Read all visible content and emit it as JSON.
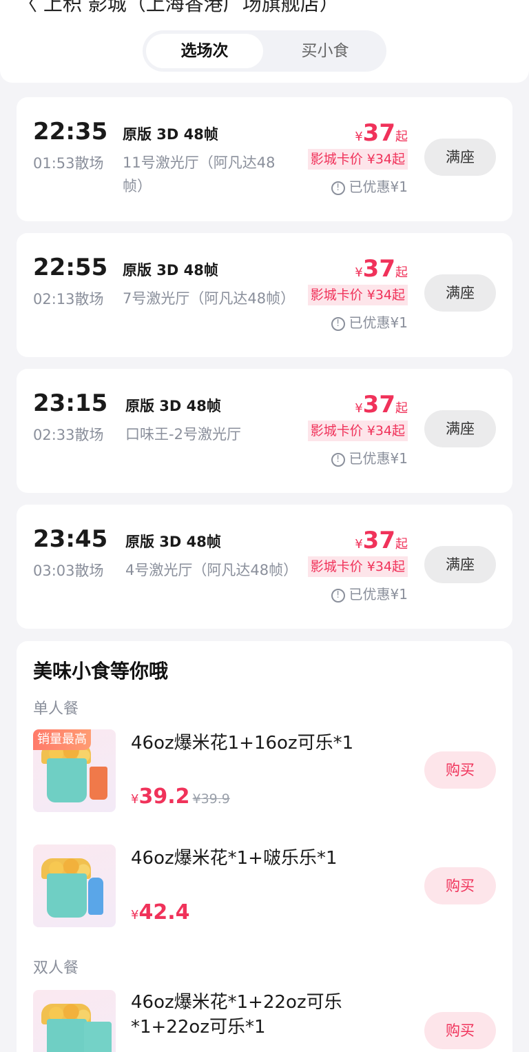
{
  "header": {
    "title_cut": "〈  上积        影城（上海香港广场旗舰店）",
    "tabs": [
      "选场次",
      "买小食"
    ]
  },
  "showtimes": [
    {
      "time": "22:35",
      "end": "01:53散场",
      "format": "原版 3D 48帧",
      "hall": "11号激光厅（阿凡达48帧）",
      "yen": "¥",
      "price": "37",
      "qi": "起",
      "card_price": "影城卡价 ¥34起",
      "discount": "已优惠¥1",
      "status": "满座"
    },
    {
      "time": "22:55",
      "end": "02:13散场",
      "format": "原版 3D 48帧",
      "hall": "7号激光厅（阿凡达48帧）",
      "yen": "¥",
      "price": "37",
      "qi": "起",
      "card_price": "影城卡价 ¥34起",
      "discount": "已优惠¥1",
      "status": "满座"
    },
    {
      "time": "23:15",
      "end": "02:33散场",
      "format": "原版 3D 48帧",
      "hall": "口味王-2号激光厅",
      "yen": "¥",
      "price": "37",
      "qi": "起",
      "card_price": "影城卡价 ¥34起",
      "discount": "已优惠¥1",
      "status": "满座"
    },
    {
      "time": "23:45",
      "end": "03:03散场",
      "format": "原版 3D 48帧",
      "hall": "4号激光厅（阿凡达48帧）",
      "yen": "¥",
      "price": "37",
      "qi": "起",
      "card_price": "影城卡价 ¥34起",
      "discount": "已优惠¥1",
      "status": "满座"
    }
  ],
  "snacks": {
    "title": "美味小食等你哦",
    "single_label": "单人餐",
    "double_label": "双人餐",
    "items": [
      {
        "badge": "销量最高",
        "name": "46oz爆米花1+16oz可乐*1",
        "yen": "¥",
        "price": "39.2",
        "original": "¥39.9",
        "buy": "购买"
      },
      {
        "name": "46oz爆米花*1+啵乐乐*1",
        "yen": "¥",
        "price": "42.4",
        "buy": "购买"
      },
      {
        "name": "46oz爆米花*1+22oz可乐*1+22oz可乐*1",
        "buy": "购买"
      }
    ]
  },
  "icons": {
    "discount": "info-circle-icon"
  },
  "colors": {
    "accent": "#f0325a",
    "background": "#f4f4f7"
  }
}
